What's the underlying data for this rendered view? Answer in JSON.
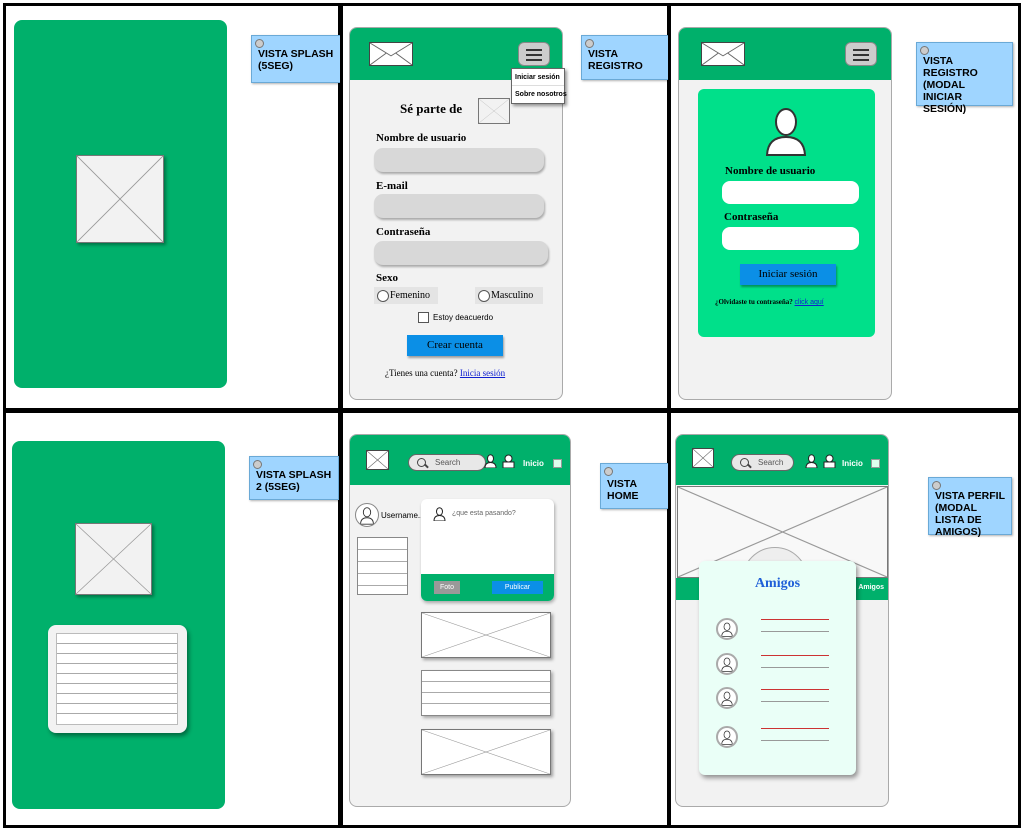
{
  "notes": {
    "splash": "VISTA SPLASH (5SEG)",
    "registro": "VISTA REGISTRO",
    "registro_modal": "VISTA REGISTRO (MODAL INICIAR SESIÓN)",
    "splash2": "VISTA SPLASH 2 (5SEG)",
    "home": "VISTA HOME",
    "perfil": "VISTA PERFIL (MODAL LISTA DE AMIGOS)"
  },
  "registro": {
    "dropdown": [
      "Iniciar sesión",
      "Sobre nosotros"
    ],
    "heading": "Sé parte de",
    "username_label": "Nombre de usuario",
    "email_label": "E-mail",
    "password_label": "Contraseña",
    "sexo_label": "Sexo",
    "femenino": "Femenino",
    "masculino": "Masculino",
    "agree": "Estoy deacuerdo",
    "create_button": "Crear cuenta",
    "have_account": "¿Tienes una cuenta?",
    "login_link": "Inicia sesión"
  },
  "login_modal": {
    "username_label": "Nombre de usuario",
    "password_label": "Contraseña",
    "login_button": "Iniciar sesión",
    "forgot": "¿Olvidaste tu contraseña?",
    "click_link": "click aquí"
  },
  "home": {
    "search_placeholder": "Search",
    "inicio": "Inicio",
    "username": "Username...",
    "post_placeholder": "¿que esta pasando?",
    "foto_button": "Foto",
    "publicar_button": "Publicar"
  },
  "perfil": {
    "search_placeholder": "Search",
    "inicio": "Inicio",
    "tab_partial": "Amigos",
    "modal_title": "Amigos"
  },
  "colors": {
    "green": "#00b06b",
    "modal_green": "#00e08a",
    "button_blue": "#0b8fe6",
    "note_blue": "#9fd5ff"
  }
}
